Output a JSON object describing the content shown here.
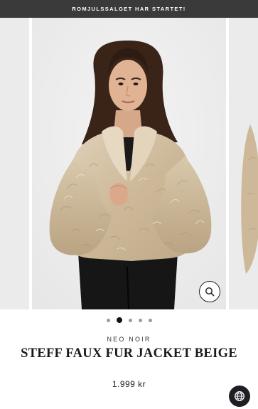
{
  "promo_bar": {
    "text": "ROMJULSSALGET HAR STARTET!"
  },
  "gallery": {
    "slide_count": 5,
    "active_slide": 2,
    "zoom_icon": "magnifier-icon"
  },
  "product": {
    "brand": "NEO NOIR",
    "title": "STEFF FAUX FUR JACKET BEIGE",
    "price": "1.999 kr"
  },
  "floating": {
    "locale_icon": "globe-icon"
  },
  "colors": {
    "promo_bg": "#3a3a3a",
    "fur": "#d4c2a6",
    "pants": "#161616",
    "globe_bg": "#1e1e24"
  }
}
